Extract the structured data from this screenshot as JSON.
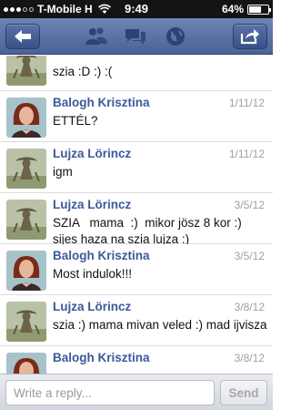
{
  "status_bar": {
    "carrier": "T-Mobile H",
    "time": "9:49",
    "battery_percent_label": "64%",
    "battery_level": 0.64
  },
  "nav_bar": {
    "icons": [
      "back-arrow-icon",
      "friends-icon",
      "messages-icon",
      "globe-icon",
      "share-icon"
    ],
    "accent_color": "#4b6298"
  },
  "messages": [
    {
      "sender": "",
      "date": "",
      "text": "szia :D :) :(",
      "avatar": "lujza-avatar"
    },
    {
      "sender": "Balogh Krisztina",
      "date": "1/11/12",
      "text": "ETTÉL?",
      "avatar": "krisztina-avatar"
    },
    {
      "sender": "Lujza Lörincz",
      "date": "1/11/12",
      "text": "igm",
      "avatar": "lujza-avatar"
    },
    {
      "sender": "Lujza Lörincz",
      "date": "3/5/12",
      "text": "SZIA   mama  :)  mikor jösz 8 kor :) sijes haza na szia lujza :)",
      "avatar": "lujza-avatar"
    },
    {
      "sender": "Balogh Krisztina",
      "date": "3/5/12",
      "text": "Most indulok!!!",
      "avatar": "krisztina-avatar"
    },
    {
      "sender": "Lujza Lörincz",
      "date": "3/8/12",
      "text": "szia :) mama mivan veled :) mad ijvisza",
      "avatar": "lujza-avatar"
    },
    {
      "sender": "Balogh Krisztina",
      "date": "3/8/12",
      "text": "",
      "avatar": "krisztina-avatar"
    }
  ],
  "reply": {
    "placeholder": "Write a reply...",
    "value": "",
    "send_label": "Send"
  },
  "colors": {
    "sender_name": "#3b5a9a",
    "date": "#a0a0a0"
  }
}
